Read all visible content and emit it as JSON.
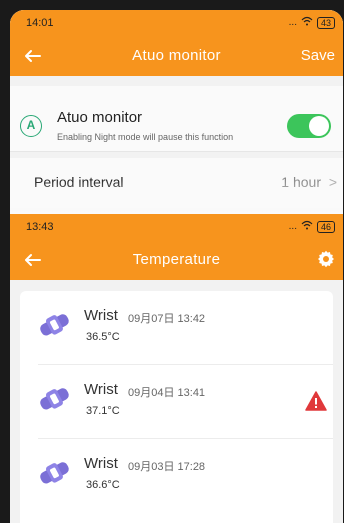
{
  "screen1": {
    "status": {
      "time": "14:01",
      "signal": "... ",
      "battery": "43"
    },
    "appbar": {
      "title": "Atuo monitor",
      "save_label": "Save"
    },
    "auto_monitor": {
      "title": "Atuo monitor",
      "subtitle": "Enabling Night mode will pause this function",
      "toggle_on": true
    },
    "period": {
      "label": "Period interval",
      "value": "1 hour",
      "chevron": ">"
    }
  },
  "screen2": {
    "status": {
      "time": "13:43",
      "signal": "... ",
      "battery": "46"
    },
    "appbar": {
      "title": "Temperature"
    },
    "records": [
      {
        "name": "Wrist",
        "date": "09月07日 13:42",
        "temp": "36.5°C",
        "warning": false
      },
      {
        "name": "Wrist",
        "date": "09月04日 13:41",
        "temp": "37.1°C",
        "warning": true
      },
      {
        "name": "Wrist",
        "date": "09月03日 17:28",
        "temp": "36.6°C",
        "warning": false
      }
    ]
  },
  "colors": {
    "orange": "#f7941d",
    "green": "#3cc55b",
    "warning_red": "#e0383b",
    "icon_purple": "#7b6fd6"
  },
  "icons": [
    "back-arrow-icon",
    "auto-a-icon",
    "gear-icon",
    "wrist-icon",
    "warning-icon",
    "chevron-right-icon"
  ]
}
